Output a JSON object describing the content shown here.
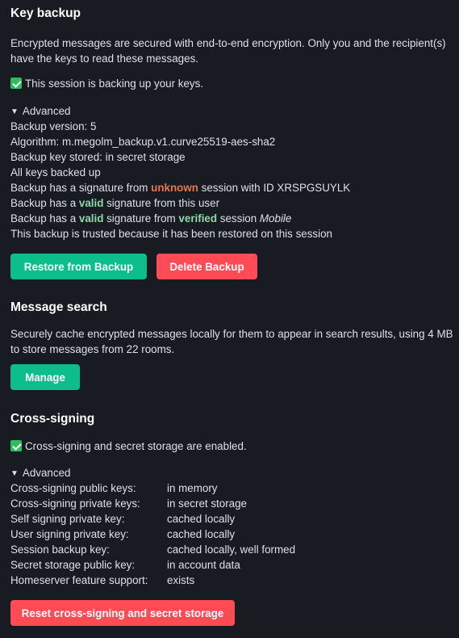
{
  "key_backup": {
    "title": "Key backup",
    "description": "Encrypted messages are secured with end-to-end encryption. Only you and the recipient(s) have the keys to read these messages.",
    "status": "This session is backing up your keys.",
    "advanced_label": "Advanced",
    "backup_version": "Backup version: 5",
    "algorithm": "Algorithm: m.megolm_backup.v1.curve25519-aes-sha2",
    "key_stored": "Backup key stored: in secret storage",
    "all_backed_up": "All keys backed up",
    "sig1_prefix": "Backup has a signature from ",
    "sig1_keyword": "unknown",
    "sig1_suffix": " session with ID XRSPGSUYLK",
    "sig2_prefix": "Backup has a ",
    "sig2_keyword": "valid",
    "sig2_suffix": " signature from this user",
    "sig3_prefix": "Backup has a ",
    "sig3_keyword": "valid",
    "sig3_middle": " signature from ",
    "sig3_keyword2": "verified",
    "sig3_middle2": " session ",
    "sig3_session": "Mobile",
    "trusted": "This backup is trusted because it has been restored on this session",
    "restore_button": "Restore from Backup",
    "delete_button": "Delete Backup"
  },
  "message_search": {
    "title": "Message search",
    "description": "Securely cache encrypted messages locally for them to appear in search results, using 4 MB to store messages from 22 rooms.",
    "manage_button": "Manage"
  },
  "cross_signing": {
    "title": "Cross-signing",
    "status": "Cross-signing and secret storage are enabled.",
    "advanced_label": "Advanced",
    "rows": [
      {
        "label": "Cross-signing public keys:",
        "value": "in memory"
      },
      {
        "label": "Cross-signing private keys:",
        "value": "in secret storage"
      },
      {
        "label": "Self signing private key:",
        "value": "cached locally"
      },
      {
        "label": "User signing private key:",
        "value": "cached locally"
      },
      {
        "label": "Session backup key:",
        "value": "cached locally, well formed"
      },
      {
        "label": "Secret storage public key:",
        "value": "in account data"
      },
      {
        "label": "Homeserver feature support:",
        "value": "exists"
      }
    ],
    "reset_button": "Reset cross-signing and secret storage"
  },
  "colors": {
    "background": "#181b21",
    "accent_green": "#0dbd8b",
    "danger_red": "#ff4b55",
    "unknown_orange": "#e8764e",
    "valid_green": "#8fd8a8"
  },
  "icons": [
    "check-mark-icon",
    "disclosure-triangle-icon"
  ]
}
